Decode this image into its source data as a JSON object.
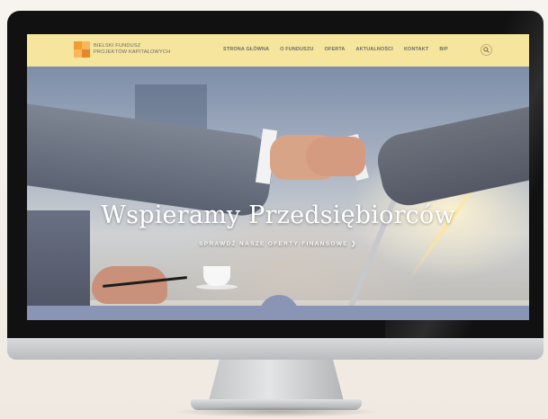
{
  "brand": {
    "line1": "BIELSKI FUNDUSZ",
    "line2": "PROJEKTÓW KAPITAŁOWYCH",
    "logo_colors": [
      "#f39c32",
      "#f7b85a",
      "#e8862a"
    ]
  },
  "nav": {
    "items": [
      "STRONA GŁÓWNA",
      "O FUNDUSZU",
      "OFERTA",
      "AKTUALNOŚCI",
      "KONTAKT",
      "BIP"
    ],
    "search_icon": "search-icon",
    "background": "#f6e59c"
  },
  "hero": {
    "headline": "Wspieramy Przedsiębiorców",
    "subline": "SPRAWDŹ NASZE OFERTY FINANSOWE"
  },
  "footer_bar": {
    "color": "#8a95b6"
  }
}
